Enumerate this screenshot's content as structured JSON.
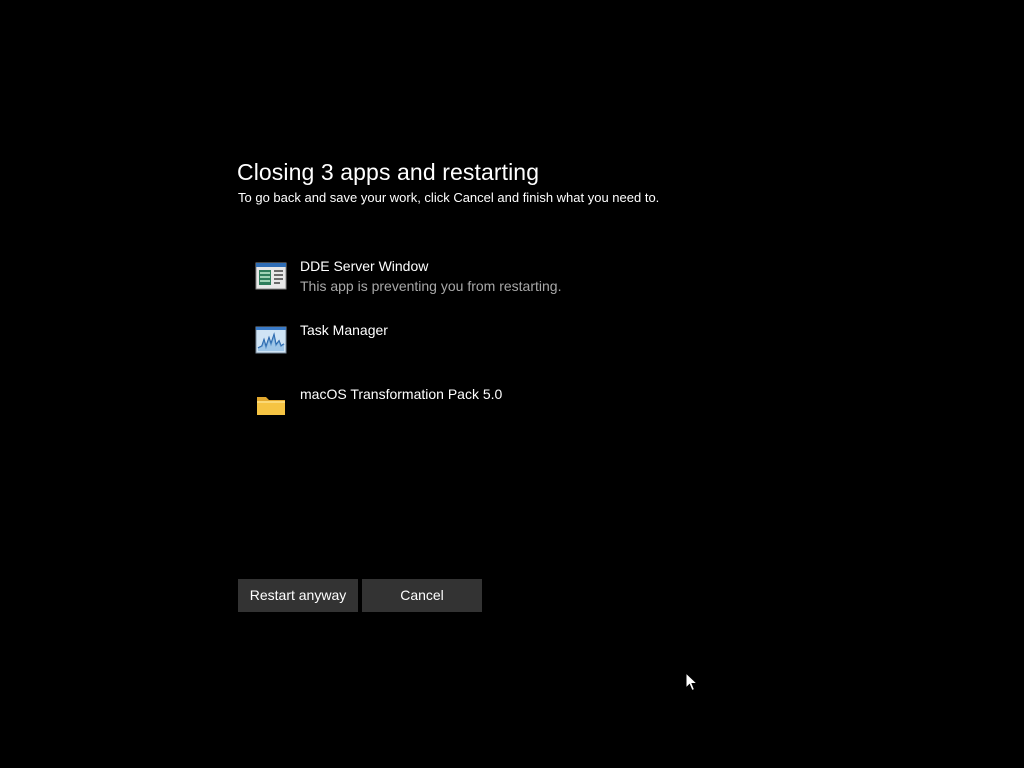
{
  "dialog": {
    "title": "Closing 3 apps and restarting",
    "subtitle": "To go back and save your work, click Cancel and finish what you need to."
  },
  "apps": [
    {
      "name": "DDE Server Window",
      "detail": "This app is preventing you from restarting.",
      "icon": "dde-window-icon"
    },
    {
      "name": "Task Manager",
      "detail": "",
      "icon": "task-manager-icon"
    },
    {
      "name": "macOS Transformation Pack 5.0",
      "detail": "",
      "icon": "folder-icon"
    }
  ],
  "buttons": {
    "restart_label": "Restart anyway",
    "cancel_label": "Cancel"
  },
  "colors": {
    "background": "#000000",
    "text": "#ffffff",
    "detail_text": "#a8a8a8",
    "button_bg": "#333333",
    "folder_yellow": "#f6c443"
  }
}
